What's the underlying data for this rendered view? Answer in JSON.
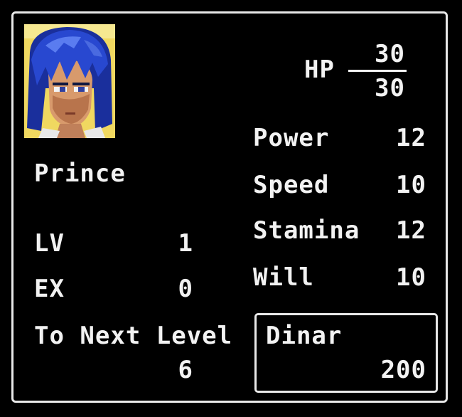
{
  "character": {
    "name": "Prince",
    "portrait_icon": "prince-portrait"
  },
  "hp": {
    "label": "HP",
    "current": "30",
    "max": "30"
  },
  "stats": {
    "lv_label": "LV",
    "lv_value": "1",
    "ex_label": "EX",
    "ex_value": "0",
    "next_label": "To Next Level",
    "next_value": "6"
  },
  "attributes": [
    {
      "label": "Power",
      "value": "12"
    },
    {
      "label": "Speed",
      "value": "10"
    },
    {
      "label": "Stamina",
      "value": "12"
    },
    {
      "label": "Will",
      "value": "10"
    }
  ],
  "money": {
    "label": "Dinar",
    "value": "200"
  },
  "colors": {
    "background": "#000000",
    "text": "#f2f2f2",
    "border": "#e8e8e8",
    "portrait_bg": "#f0d860",
    "hair": "#2040c0"
  }
}
